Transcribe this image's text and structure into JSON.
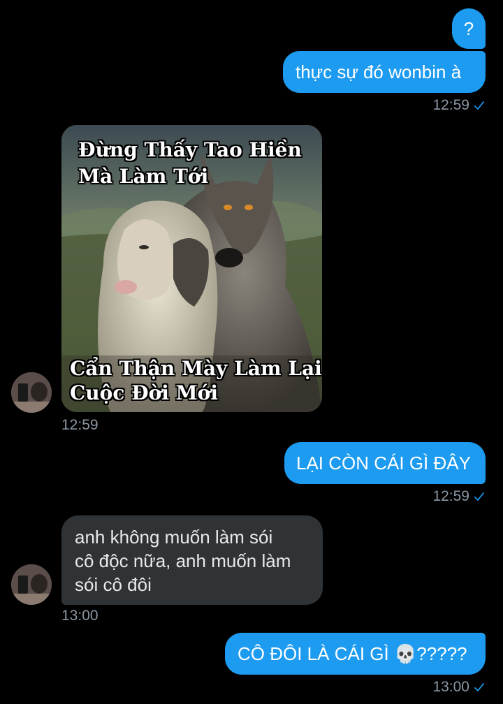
{
  "colors": {
    "background": "#000000",
    "sent_bubble": "#1d9bf0",
    "received_bubble": "#2f3336",
    "timestamp": "#8b98a5",
    "read_check": "#1d9bf0"
  },
  "messages": [
    {
      "direction": "sent",
      "text": "?"
    },
    {
      "direction": "sent",
      "text": "thực sự đó wonbin à",
      "time": "12:59",
      "status_icon": "read-check-icon"
    },
    {
      "direction": "received",
      "type": "image",
      "image": {
        "description_icon": "wolf-and-sheep-meme-image",
        "caption_top": [
          "Đừng Thấy Tao Hiền",
          "Mà Làm Tới"
        ],
        "caption_bottom": [
          "Cẩn Thận Mày Làm Lại",
          "Cuộc Đời Mới"
        ]
      },
      "time": "12:59",
      "avatar": "user-avatar"
    },
    {
      "direction": "sent",
      "text": "LẠI CÒN CÁI GÌ ĐÂY",
      "time": "12:59",
      "status_icon": "read-check-icon"
    },
    {
      "direction": "received",
      "lines": [
        "anh không muốn làm sói",
        "cô độc nữa, anh muốn làm",
        "sói cô đôi"
      ],
      "time": "13:00",
      "avatar": "user-avatar"
    },
    {
      "direction": "sent",
      "text": "CÔ ĐÔI LÀ CÁI GÌ",
      "emoji": "💀",
      "suffix": "?????",
      "time": "13:00",
      "status_icon": "read-check-icon"
    }
  ]
}
